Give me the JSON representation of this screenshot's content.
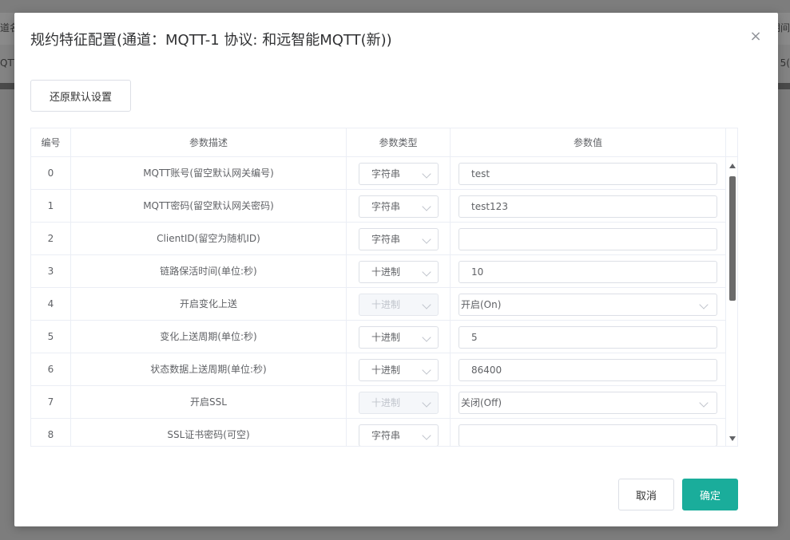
{
  "background": {
    "left_header": "道名",
    "left_row": "QTT",
    "right_header": "期间",
    "right_row": "5("
  },
  "dialog": {
    "title": "规约特征配置(通道：MQTT-1 协议: 和远智能MQTT(新))",
    "close_icon": "×",
    "restore_label": "还原默认设置",
    "cancel_label": "取消",
    "ok_label": "确定"
  },
  "table": {
    "headers": [
      "编号",
      "参数描述",
      "参数类型",
      "参数值"
    ],
    "rows": [
      {
        "id": "0",
        "desc": "MQTT账号(留空默认网关编号)",
        "type": "字符串",
        "type_disabled": false,
        "value": "test",
        "value_kind": "input"
      },
      {
        "id": "1",
        "desc": "MQTT密码(留空默认网关密码)",
        "type": "字符串",
        "type_disabled": false,
        "value": "test123",
        "value_kind": "input"
      },
      {
        "id": "2",
        "desc": "ClientID(留空为随机ID)",
        "type": "字符串",
        "type_disabled": false,
        "value": "",
        "value_kind": "input"
      },
      {
        "id": "3",
        "desc": "链路保活时间(单位:秒)",
        "type": "十进制",
        "type_disabled": false,
        "value": "10",
        "value_kind": "input"
      },
      {
        "id": "4",
        "desc": "开启变化上送",
        "type": "十进制",
        "type_disabled": true,
        "value": "开启(On)",
        "value_kind": "select"
      },
      {
        "id": "5",
        "desc": "变化上送周期(单位:秒)",
        "type": "十进制",
        "type_disabled": false,
        "value": "5",
        "value_kind": "input"
      },
      {
        "id": "6",
        "desc": "状态数据上送周期(单位:秒)",
        "type": "十进制",
        "type_disabled": false,
        "value": "86400",
        "value_kind": "input"
      },
      {
        "id": "7",
        "desc": "开启SSL",
        "type": "十进制",
        "type_disabled": true,
        "value": "关闭(Off)",
        "value_kind": "select"
      },
      {
        "id": "8",
        "desc": "SSL证书密码(可空)",
        "type": "字符串",
        "type_disabled": false,
        "value": "",
        "value_kind": "input"
      }
    ]
  },
  "colors": {
    "primary": "#1aad9b",
    "border": "#dcdfe6",
    "text": "#606266"
  }
}
